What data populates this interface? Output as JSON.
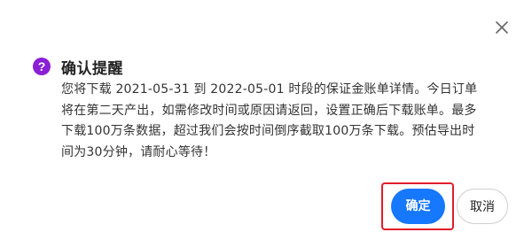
{
  "dialog": {
    "close_icon": "close-icon",
    "header_icon": "question-mark-circle-icon",
    "header_icon_glyph": "?",
    "title": "确认提醒",
    "message": "您将下载 2021-05-31 到 2022-05-01 时段的保证金账单详情。今日订单将在第二天产出，如需修改时间或原因请返回，设置正确后下载账单。最多下载100万条数据，超过我们会按时间倒序截取100万条下载。预估导出时间为30分钟，请耐心等待！",
    "confirm_label": "确定",
    "cancel_label": "取消"
  },
  "colors": {
    "primary_button": "#1677ff",
    "icon_purple": "#8a1fd6",
    "highlight_border": "#e21d2a"
  }
}
